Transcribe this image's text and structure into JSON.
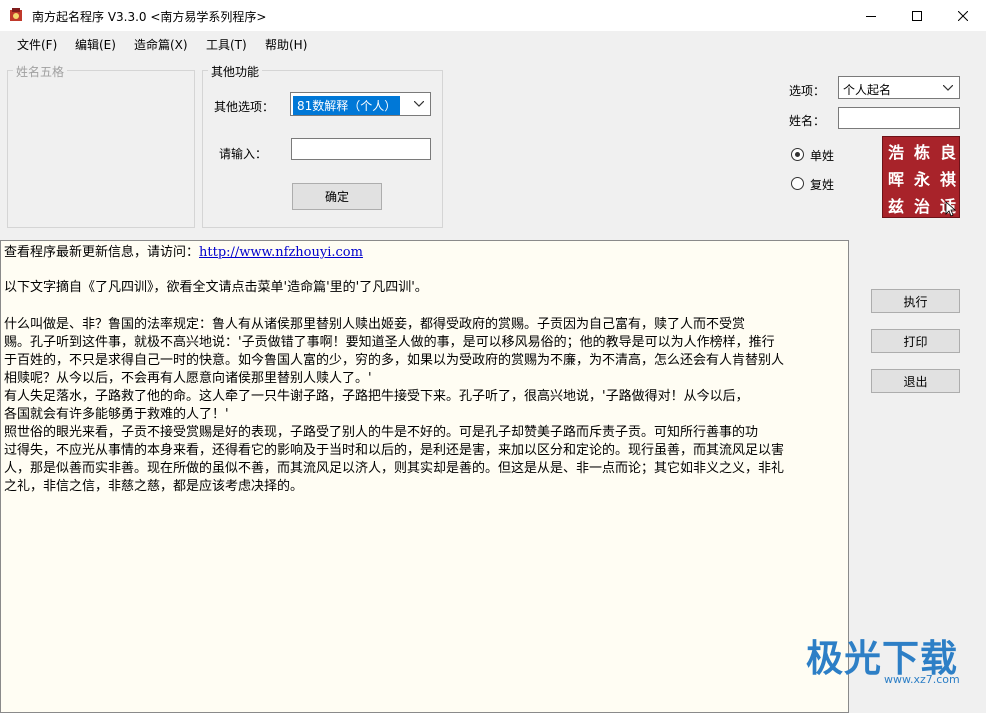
{
  "window": {
    "title": "南方起名程序 V3.3.0   <南方易学系列程序>"
  },
  "menu": [
    "文件(F)",
    "编辑(E)",
    "造命篇(X)",
    "工具(T)",
    "帮助(H)"
  ],
  "left_group": {
    "title": "姓名五格"
  },
  "other_group": {
    "title": "其他功能",
    "option_label": "其他选项：",
    "option_value": "81数解释（个人）",
    "input_label": "请输入：",
    "input_value": "",
    "confirm_label": "确定"
  },
  "right_panel": {
    "option_label": "选项：",
    "option_value": "个人起名",
    "name_label": "姓名：",
    "name_value": "",
    "radio_single": "单姓",
    "radio_double": "复姓",
    "radio_selected": "单姓",
    "seal_chars": [
      "浩",
      "栋",
      "良",
      "晖",
      "永",
      "祺",
      "兹",
      "治",
      "适"
    ]
  },
  "actions": {
    "execute": "执行",
    "print": "打印",
    "exit": "退出"
  },
  "text_area": {
    "update_prefix": "查看程序最新更新信息，请访问：",
    "update_url": "http://www.nfzhouyi.com",
    "lines": [
      "以下文字摘自《了凡四训》，欲看全文请点击菜单'造命篇'里的'了凡四训'。",
      "      什么叫做是、非？鲁国的法率规定：鲁人有从诸侯那里替别人赎出姬妾，都得受政府的赏赐。子贡因为自己富有，赎了人而不受赏",
      "赐。孔子听到这件事，就极不高兴地说：'子贡做错了事啊！要知道圣人做的事，是可以移风易俗的；他的教导是可以为人作榜样，推行",
      "于百姓的，不只是求得自己一时的快意。如今鲁国人富的少，穷的多，如果以为受政府的赏赐为不廉，为不清高，怎么还会有人肯替别人",
      "相赎呢？从今以后，不会再有人愿意向诸侯那里替别人赎人了。'",
      "      有人失足落水，子路救了他的命。这人牵了一只牛谢子路，子路把牛接受下来。孔子听了，很高兴地说，'子路做得对！从今以后，",
      "各国就会有许多能够勇于救难的人了！'",
      "      照世俗的眼光来看，子贡不接受赏赐是好的表现，子路受了别人的牛是不好的。可是孔子却赞美子路而斥责子贡。可知所行善事的功",
      "过得失，不应光从事情的本身来看，还得看它的影响及于当时和以后的，是利还是害，来加以区分和定论的。现行虽善，而其流风足以害",
      "人，那是似善而实非善。现在所做的虽似不善，而其流风足以济人，则其实却是善的。但这是从是、非一点而论；其它如非义之义，非礼",
      "之礼，非信之信，非慈之慈，都是应该考虑决择的。"
    ]
  },
  "watermark": {
    "brand": "极光下载",
    "url": "www.xz7.com"
  }
}
